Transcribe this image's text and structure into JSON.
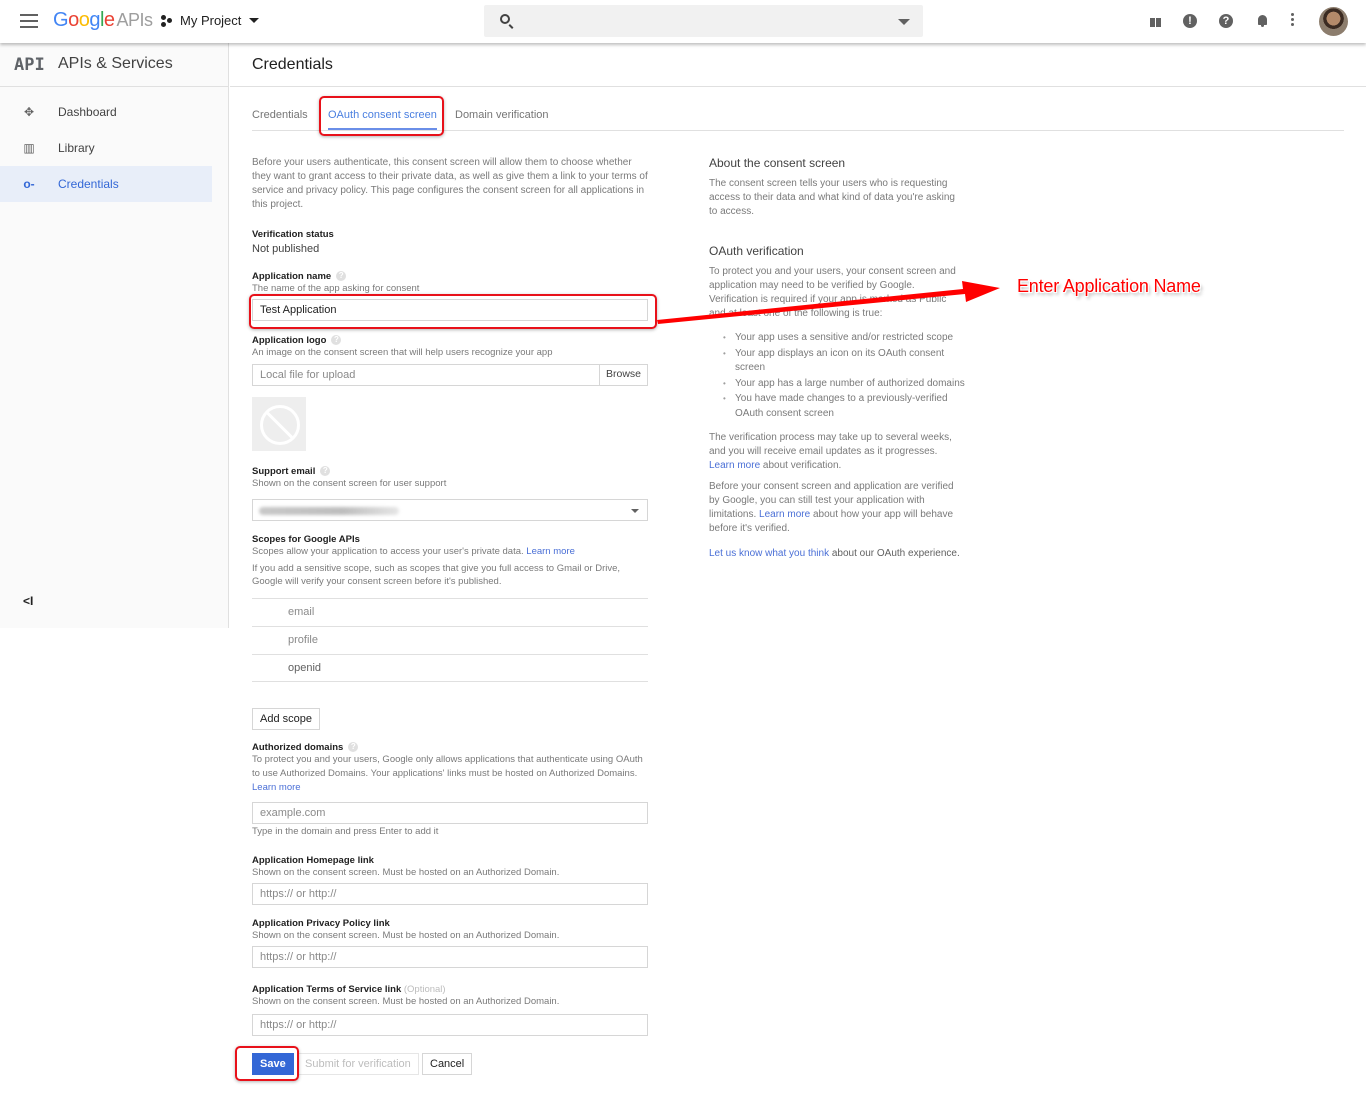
{
  "topbar": {
    "logo_google": [
      "G",
      "o",
      "o",
      "g",
      "l",
      "e"
    ],
    "logo_apis": "APIs",
    "project_name": "My Project",
    "search_placeholder": "",
    "icons": [
      "gift-icon",
      "feedback-icon",
      "help-icon",
      "notifications-icon",
      "more-vert-icon",
      "account-avatar"
    ]
  },
  "sidebar": {
    "badge": "API",
    "title": "APIs & Services",
    "items": [
      {
        "label": "Dashboard",
        "icon": "dashboard-icon",
        "active": false
      },
      {
        "label": "Library",
        "icon": "library-icon",
        "active": false
      },
      {
        "label": "Credentials",
        "icon": "key-icon",
        "active": true
      }
    ],
    "collapse_label": "<I"
  },
  "page": {
    "title": "Credentials",
    "tabs": [
      {
        "label": "Credentials",
        "active": false
      },
      {
        "label": "OAuth consent screen",
        "active": true
      },
      {
        "label": "Domain verification",
        "active": false
      }
    ]
  },
  "form": {
    "intro": "Before your users authenticate, this consent screen will allow them to choose whether they want to grant access to their private data, as well as give them a link to your terms of service and privacy policy. This page configures the consent screen for all applications in this project.",
    "verification_status_label": "Verification status",
    "verification_status_value": "Not published",
    "app_name_label": "Application name",
    "app_name_help": "The name of the app asking for consent",
    "app_name_value": "Test Application",
    "app_logo_label": "Application logo",
    "app_logo_help": "An image on the consent screen that will help users recognize your app",
    "app_logo_placeholder": "Local file for upload",
    "browse_label": "Browse",
    "support_email_label": "Support email",
    "support_email_help": "Shown on the consent screen for user support",
    "support_email_value": "(redacted)",
    "scopes_label": "Scopes for Google APIs",
    "scopes_help": "Scopes allow your application to access your user's private data.",
    "scopes_learn_more": "Learn more",
    "scopes_note": "If you add a sensitive scope, such as scopes that give you full access to Gmail or Drive, Google will verify your consent screen before it's published.",
    "scopes": [
      "email",
      "profile",
      "openid"
    ],
    "add_scope_label": "Add scope",
    "auth_domains_label": "Authorized domains",
    "auth_domains_help": "To protect you and your users, Google only allows applications that authenticate using OAuth to use Authorized Domains. Your applications' links must be hosted on Authorized Domains.",
    "auth_domains_learn_more": "Learn more",
    "auth_domains_placeholder": "example.com",
    "auth_domains_hint": "Type in the domain and press Enter to add it",
    "homepage_label": "Application Homepage link",
    "homepage_help": "Shown on the consent screen. Must be hosted on an Authorized Domain.",
    "homepage_placeholder": "https:// or http://",
    "privacy_label": "Application Privacy Policy link",
    "privacy_help": "Shown on the consent screen. Must be hosted on an Authorized Domain.",
    "privacy_placeholder": "https:// or http://",
    "tos_label": "Application Terms of Service link",
    "tos_optional": "(Optional)",
    "tos_help": "Shown on the consent screen. Must be hosted on an Authorized Domain.",
    "tos_placeholder": "https:// or http://",
    "save_label": "Save",
    "submit_label": "Submit for verification",
    "cancel_label": "Cancel"
  },
  "info": {
    "about_title": "About the consent screen",
    "about_text": "The consent screen tells your users who is requesting access to their data and what kind of data you're asking to access.",
    "verif_title": "OAuth verification",
    "verif_text": "To protect you and your users, your consent screen and application may need to be verified by Google. Verification is required if your app is marked as Public and at least one of the following is true:",
    "verif_items": [
      "Your app uses a sensitive and/or restricted scope",
      "Your app displays an icon on its OAuth consent screen",
      "Your app has a large number of authorized domains",
      "You have made changes to a previously-verified OAuth consent screen"
    ],
    "process_text_pre": "The verification process may take up to several weeks, and you will receive email updates as it progresses.",
    "process_link": "Learn more",
    "process_text_post": "about verification.",
    "before_text_pre": "Before your consent screen and application are verified by Google, you can still test your application with limitations.",
    "before_link": "Learn more",
    "before_text_post": "about how your app will behave before it's verified.",
    "feedback_link": "Let us know what you think",
    "feedback_post": "about our OAuth experience."
  },
  "annotation": {
    "callout_text": "Enter Application Name",
    "color": "#ff0000"
  },
  "colors": {
    "accent": "#3367d6",
    "tab_active": "#4a7fe0",
    "highlight": "#e8111a",
    "sidebar_active_bg": "#e8eef9"
  }
}
